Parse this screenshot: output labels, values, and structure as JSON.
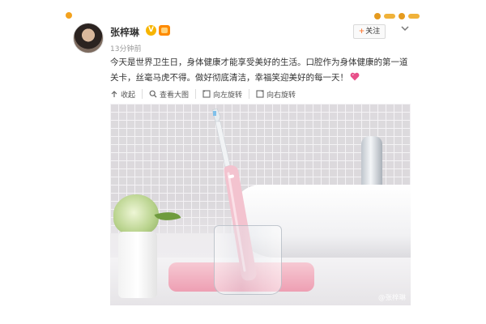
{
  "post": {
    "author_name": "张梓琳",
    "verified_badge": "V",
    "timestamp": "13分钟前",
    "follow_label": "关注",
    "follow_plus": "+",
    "text": "今天是世界卫生日，身体健康才能享受美好的生活。口腔作为身体健康的第一道关卡，丝毫马虎不得。做好彻底清洁，幸福笑迎美好的每一天！",
    "heart_emoji": "heart-icon"
  },
  "toolbar": {
    "collapse_label": "收起",
    "view_large_label": "查看大图",
    "rotate_left_label": "向左旋转",
    "rotate_right_label": "向右旋转"
  },
  "photo": {
    "watermark": "@张梓琳"
  },
  "icons": {
    "collapse": "arrow-up-icon",
    "view_large": "magnifier-icon",
    "rotate_left": "rotate-left-icon",
    "rotate_right": "rotate-right-icon",
    "more": "chevron-down-icon"
  },
  "colors": {
    "follow_plus": "#ff8140",
    "vip_badge": "#f7b500",
    "level_badge": "#ff8a00",
    "toothbrush": "#f3c3cf"
  }
}
